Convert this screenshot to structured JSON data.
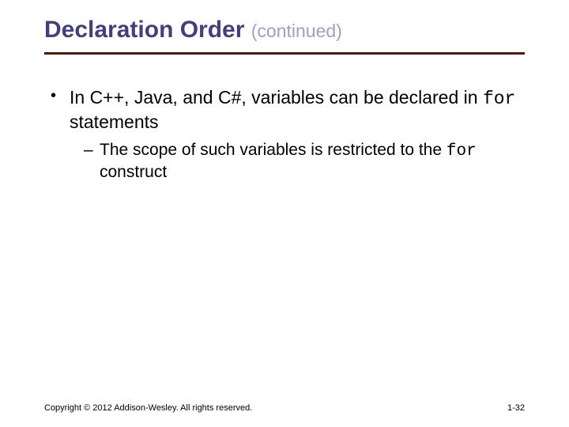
{
  "title": {
    "main": "Declaration Order ",
    "sub": "(continued)"
  },
  "bullets": {
    "l1": {
      "pre": "In C++, Java, and C#, variables can be declared in ",
      "code": "for",
      "post": " statements"
    },
    "l2": {
      "pre": "The scope of such variables is restricted to the ",
      "code": "for",
      "post": " construct"
    }
  },
  "footer": {
    "copyright": "Copyright © 2012 Addison-Wesley. All rights reserved.",
    "page": "1-32"
  }
}
